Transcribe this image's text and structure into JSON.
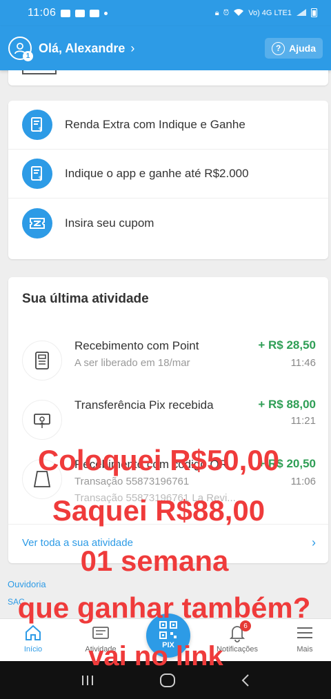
{
  "status_bar": {
    "time": "11:06",
    "network": "Vo) 4G LTE1"
  },
  "header": {
    "greeting": "Olá, Alexandre",
    "avatar_badge": "1",
    "help_label": "Ajuda",
    "accent": "#2d9be6"
  },
  "promos": [
    {
      "label": "Renda Extra com Indique e Ganhe",
      "icon": "receipt-icon"
    },
    {
      "label": "Indique o app e ganhe até R$2.000",
      "icon": "receipt-icon"
    },
    {
      "label": "Insira seu cupom",
      "icon": "coupon-icon"
    }
  ],
  "activity": {
    "title": "Sua última atividade",
    "items": [
      {
        "title": "Recebimento com Point",
        "subtitle": "A ser liberado em 18/mar",
        "detail": "",
        "amount": "+ R$ 28,50",
        "time": "11:46",
        "icon": "point-terminal-icon"
      },
      {
        "title": "Transferência Pix recebida",
        "subtitle": "",
        "detail": "",
        "amount": "+ R$ 88,00",
        "time": "11:21",
        "icon": "pix-transfer-icon"
      },
      {
        "title": "Recebimento com código QR",
        "subtitle": "Transação 55873196761",
        "detail": "Transação 55873196761 La Revi...",
        "amount": "+ R$ 20,50",
        "time": "11:06",
        "icon": "qr-receipt-icon"
      }
    ],
    "see_all": "Ver toda a sua atividade"
  },
  "footer_links": {
    "ouvidoria": "Ouvidoria",
    "sac": "SAC"
  },
  "bottom_nav": {
    "home": "Início",
    "activity": "Atividade",
    "pix": "PIX",
    "notifications": "Notificações",
    "notifications_count": "6",
    "more": "Mais"
  },
  "overlay_text": {
    "line1": "Coloquei R$50,00",
    "line2": "Saquei R$88,00",
    "line3": "01 semana",
    "line4": "que ganhar também?",
    "line5": "vai no link"
  },
  "colors": {
    "amount_positive": "#2e9e55",
    "overlay": "#ef3b3b",
    "notif_badge": "#e53935"
  }
}
